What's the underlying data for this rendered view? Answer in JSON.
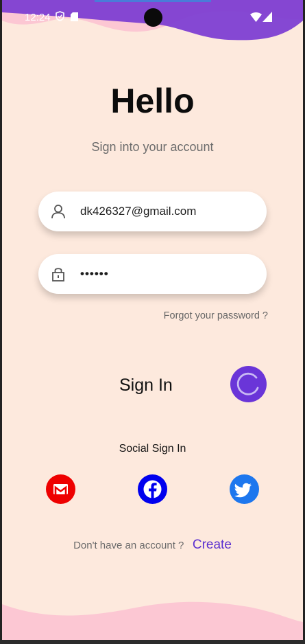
{
  "status_bar": {
    "time": "12:24"
  },
  "header": {
    "title": "Hello",
    "subtitle": "Sign into your account"
  },
  "form": {
    "email_value": "dk426327@gmail.com",
    "password_value": "••••••",
    "forgot_label": "Forgot your password ?"
  },
  "signin": {
    "label": "Sign In"
  },
  "social": {
    "title": "Social Sign In",
    "providers": [
      "gmail-icon",
      "facebook-icon",
      "twitter-icon"
    ]
  },
  "footer": {
    "no_account_text": "Don't have an account ?",
    "create_label": "Create"
  },
  "colors": {
    "accent": "#6a35d8",
    "background": "#fde9dd",
    "wave_pink": "#fcc7d3",
    "facebook": "#0000ee",
    "twitter": "#1d77ee",
    "gmail": "#ee0000"
  }
}
